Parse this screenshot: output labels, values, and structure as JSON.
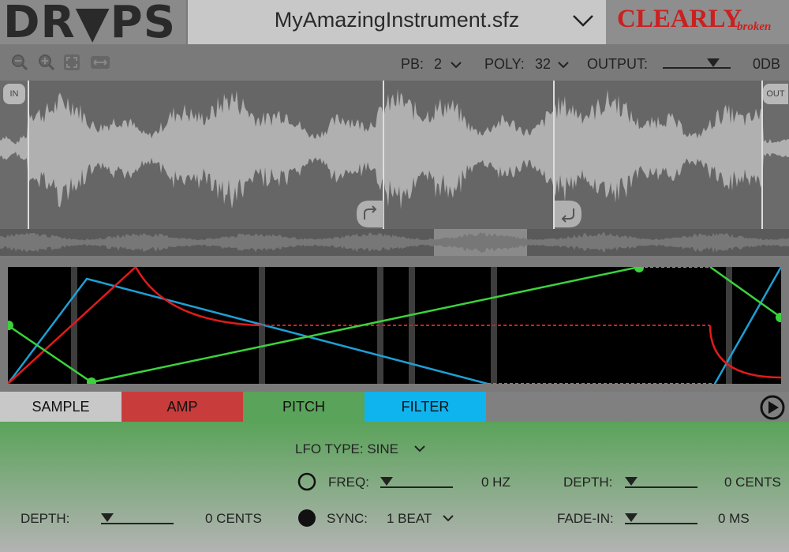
{
  "header": {
    "logo_text": "DR▼PS",
    "file_name": "MyAmazingInstrument.sfz",
    "brand_main": "CLEARLY",
    "brand_sub": "broken"
  },
  "toolbar": {
    "icons": [
      "zoom-out-icon",
      "zoom-in-icon",
      "zoom-fit-icon",
      "zoom-width-icon"
    ],
    "pb_label": "PB:",
    "pb_value": "2",
    "poly_label": "POLY:",
    "poly_value": "32",
    "output_label": "OUTPUT:",
    "output_value": "0DB"
  },
  "waveform": {
    "in_label": "IN",
    "out_label": "OUT"
  },
  "tabs": {
    "sample": "SAMPLE",
    "amp": "AMP",
    "pitch": "PITCH",
    "filter": "FILTER",
    "colors": {
      "sample": "#c8c8c8",
      "amp": "#c83c3c",
      "pitch": "#5aa35a",
      "filter": "#0fb4ee"
    }
  },
  "lfo": {
    "type_label": "LFO TYPE: SINE",
    "freq_label": "FREQ:",
    "freq_value": "0 HZ",
    "sync_label": "SYNC:",
    "sync_value": "1 BEAT",
    "depth_label": "DEPTH:",
    "depth_value": "0 CENTS",
    "fadein_label": "FADE-IN:",
    "fadein_value": "0 MS",
    "env_depth_label": "DEPTH:",
    "env_depth_value": "0 CENTS"
  }
}
